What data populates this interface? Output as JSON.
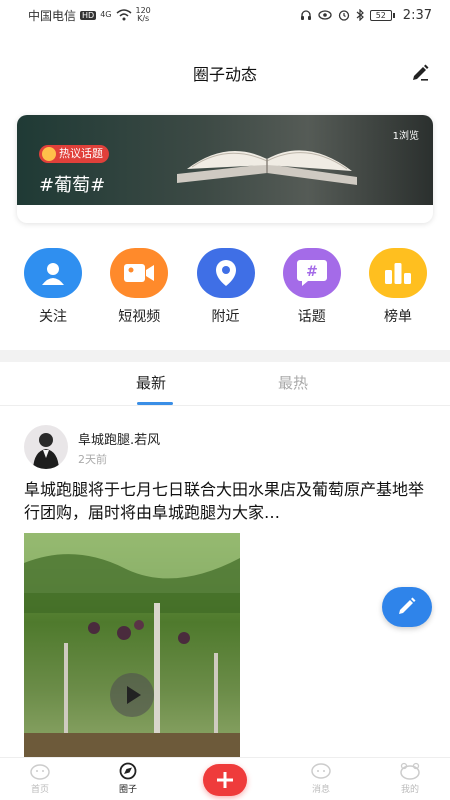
{
  "status_bar": {
    "carrier": "中国电信",
    "hd_badge": "HD",
    "signal": "4G",
    "speed_value": "120",
    "speed_unit": "K/s",
    "battery": "52",
    "time": "2:37"
  },
  "header": {
    "title": "圈子动态"
  },
  "banner": {
    "hot_tag": "热议话题",
    "topic": "#葡萄#",
    "views": "1浏览"
  },
  "quick_nav": [
    {
      "label": "关注",
      "icon": "user-icon",
      "color": "#2f8ff0"
    },
    {
      "label": "短视频",
      "icon": "video-camera-icon",
      "color": "#ff8a2b"
    },
    {
      "label": "附近",
      "icon": "location-pin-icon",
      "color": "#3f6fe6"
    },
    {
      "label": "话题",
      "icon": "hashtag-icon",
      "color": "#a46be8"
    },
    {
      "label": "榜单",
      "icon": "ranking-icon",
      "color": "#ffbf1f"
    }
  ],
  "tabs": [
    {
      "label": "最新",
      "active": true
    },
    {
      "label": "最热",
      "active": false
    }
  ],
  "post": {
    "author": "阜城跑腿.若风",
    "time": "2天前",
    "text": "阜城跑腿将于七月七日联合大田水果店及葡萄原产基地举行团购，届时将由阜城跑腿为大家…"
  },
  "bottom_nav": [
    {
      "label": "首页",
      "icon": "home-icon"
    },
    {
      "label": "圈子",
      "icon": "compass-icon",
      "active": true
    },
    {
      "label": "",
      "icon": "add-icon"
    },
    {
      "label": "消息",
      "icon": "message-icon"
    },
    {
      "label": "我的",
      "icon": "profile-icon"
    }
  ]
}
